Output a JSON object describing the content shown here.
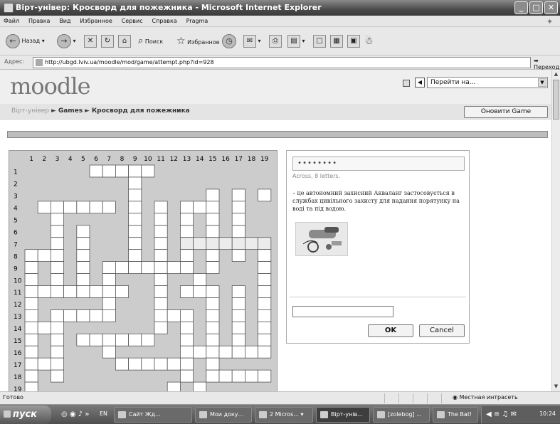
{
  "window": {
    "title": "Вірт-універ: Кросворд для пожежника - Microsoft Internet Explorer",
    "controls": [
      "_",
      "□",
      "✕"
    ]
  },
  "menu": [
    "Файл",
    "Правка",
    "Вид",
    "Избранное",
    "Сервис",
    "Справка",
    "Pragma"
  ],
  "toolbar": {
    "back_label": "Назад",
    "search_label": "Поиск",
    "favorites_label": "Избранное"
  },
  "address": {
    "label": "Адрес:",
    "url": "http://ubgd.lviv.ua/moodle/mod/game/attempt.php?id=928",
    "go_label": "Переход"
  },
  "moodle": {
    "logo": "moodle",
    "jump_select": "Перейти на...",
    "breadcrumb": {
      "home": "Вірт-універ",
      "section": "Games",
      "current": "Кросворд для пожежника",
      "sep": "►"
    },
    "refresh_button": "Оновити Game"
  },
  "crossword": {
    "columns": [
      "1",
      "2",
      "3",
      "4",
      "5",
      "6",
      "7",
      "8",
      "9",
      "10",
      "11",
      "12",
      "13",
      "14",
      "15",
      "16",
      "17",
      "18",
      "19"
    ],
    "rows": [
      "1",
      "2",
      "3",
      "4",
      "5",
      "6",
      "7",
      "8",
      "9",
      "10",
      "11",
      "12",
      "13",
      "14",
      "15",
      "16",
      "17",
      "18",
      "19"
    ],
    "highlight_row": 7,
    "highlight_cols": [
      12,
      19
    ],
    "cells": [
      "1....xxxxx.........",
      "1.......x..........",
      "1.......x.....x.x.xx",
      "1xxxxxx.x.x.xxx.x..",
      "1.x.....x.x.x.x.x..",
      "..x.x...x.x.x.x.x..",
      "..x.x...x.x.xxxxxxx",
      "xxx.x...x.x.x.x.x.x",
      "x.x.x.xxxxxxx.x...x",
      "x.x.x.x...x..x....x",
      "xxxxxxxx..x.xxx.x.x",
      "x.....x...x...x.x.x",
      "x.xxxxx...xxx.x.x.x",
      "xxx.......x.x.x.x.x",
      "x.x.xxxxxx..x.x.x.x",
      "x.x...x.....xxxxxxx",
      "xxx....xxxxxx.x....",
      "x.x.........x.xxxxx",
      "x..........x.x....."
    ]
  },
  "clue": {
    "pattern": "••••••••",
    "meta": "Across, 8 letters.",
    "text": "– це автономний захисний Акваланг застосовується в службах цивільного захисту для надання порятунку на воді та під водою.",
    "ok_label": "OK",
    "cancel_label": "Cancel"
  },
  "status": {
    "left": "Готово",
    "zone": "Местная интрасеть"
  },
  "taskbar": {
    "start": "пуск",
    "lang": "EN",
    "tasks": [
      "Сайт Жд...",
      "Мои доку...",
      "2 Micros...",
      "Вірт-унів...",
      "[zolebog] ...",
      "The Bat!"
    ],
    "clock": "10:24"
  }
}
